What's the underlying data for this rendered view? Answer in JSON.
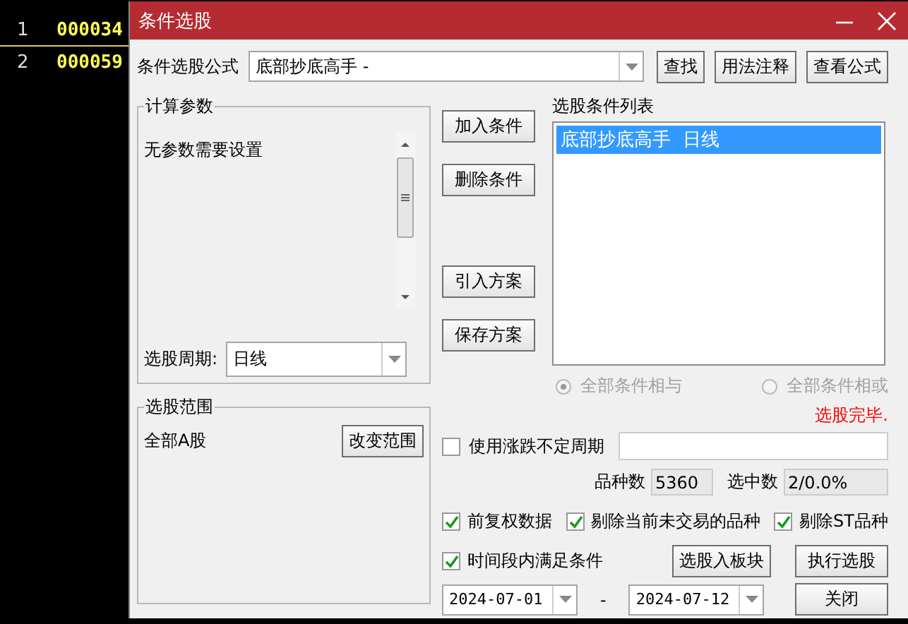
{
  "background_table": {
    "rows": [
      {
        "index": "1",
        "code": "000034",
        "selected": true
      },
      {
        "index": "2",
        "code": "000059",
        "selected": false
      }
    ]
  },
  "dialog": {
    "title": "条件选股",
    "formula": {
      "label": "条件选股公式",
      "value": "底部抄底高手 -"
    },
    "formula_buttons": [
      "查找",
      "用法注释",
      "查看公式"
    ],
    "params": {
      "title": "计算参数",
      "message": "无参数需要设置",
      "period_label": "选股周期:",
      "period_value": "日线"
    },
    "action_buttons": [
      "加入条件",
      "删除条件",
      "引入方案",
      "保存方案"
    ],
    "condition_list": {
      "title": "选股条件列表",
      "items": [
        {
          "text": "底部抄底高手  日线",
          "selected": true
        }
      ]
    },
    "logic": [
      {
        "label": "全部条件相与",
        "selected": true,
        "disabled": true
      },
      {
        "label": "全部条件相或",
        "selected": false,
        "disabled": true
      }
    ],
    "status": "选股完毕.",
    "scope": {
      "title": "选股范围",
      "value": "全部A股",
      "button": "改变范围"
    },
    "variable_period": {
      "label": "使用涨跌不定周期",
      "checked": false
    },
    "counts": [
      {
        "label": "品种数",
        "value": "5360"
      },
      {
        "label": "选中数",
        "value": "2/0.0%"
      }
    ],
    "options": [
      {
        "label": "前复权数据",
        "checked": true
      },
      {
        "label": "剔除当前未交易的品种",
        "checked": true
      },
      {
        "label": "剔除ST品种",
        "checked": true
      }
    ],
    "time_condition": {
      "label": "时间段内满足条件",
      "checked": true
    },
    "to_block_button": "选股入板块",
    "run_button": "执行选股",
    "date_from": "2024-07-01",
    "date_separator": "-",
    "date_to": "2024-07-12",
    "close_button": "关闭"
  }
}
